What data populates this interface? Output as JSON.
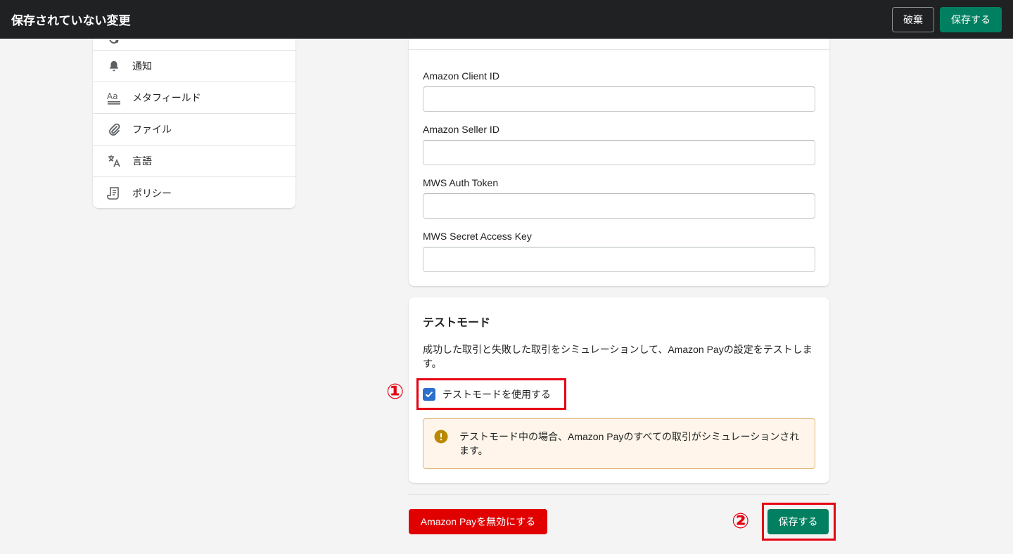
{
  "topbar": {
    "title": "保存されていない変更",
    "discard_label": "破棄",
    "save_label": "保存する"
  },
  "sidebar": {
    "items": [
      {
        "label": "通知",
        "icon": "bell-icon"
      },
      {
        "label": "メタフィールド",
        "icon": "metafields-icon"
      },
      {
        "label": "ファイル",
        "icon": "paperclip-icon"
      },
      {
        "label": "言語",
        "icon": "translate-icon"
      },
      {
        "label": "ポリシー",
        "icon": "policy-icon"
      }
    ]
  },
  "credentials": {
    "fields": [
      {
        "label": "Amazon Client ID",
        "value": ""
      },
      {
        "label": "Amazon Seller ID",
        "value": ""
      },
      {
        "label": "MWS Auth Token",
        "value": ""
      },
      {
        "label": "MWS Secret Access Key",
        "value": ""
      }
    ]
  },
  "test_mode": {
    "title": "テストモード",
    "description": "成功した取引と失敗した取引をシミュレーションして、Amazon Payの設定をテストします。",
    "checkbox_label": "テストモードを使用する",
    "checked": true,
    "banner_text": "テストモード中の場合、Amazon Payのすべての取引がシミュレーションされます。"
  },
  "footer": {
    "disable_label": "Amazon Payを無効にする",
    "save_label": "保存する"
  },
  "annotations": [
    "①",
    "②"
  ],
  "colors": {
    "topbar": "#202123",
    "primary": "#008060",
    "critical": "#e10000",
    "checkbox": "#2c6ecb",
    "warning_bg": "#fff5ea",
    "annotation": "#e60012"
  }
}
